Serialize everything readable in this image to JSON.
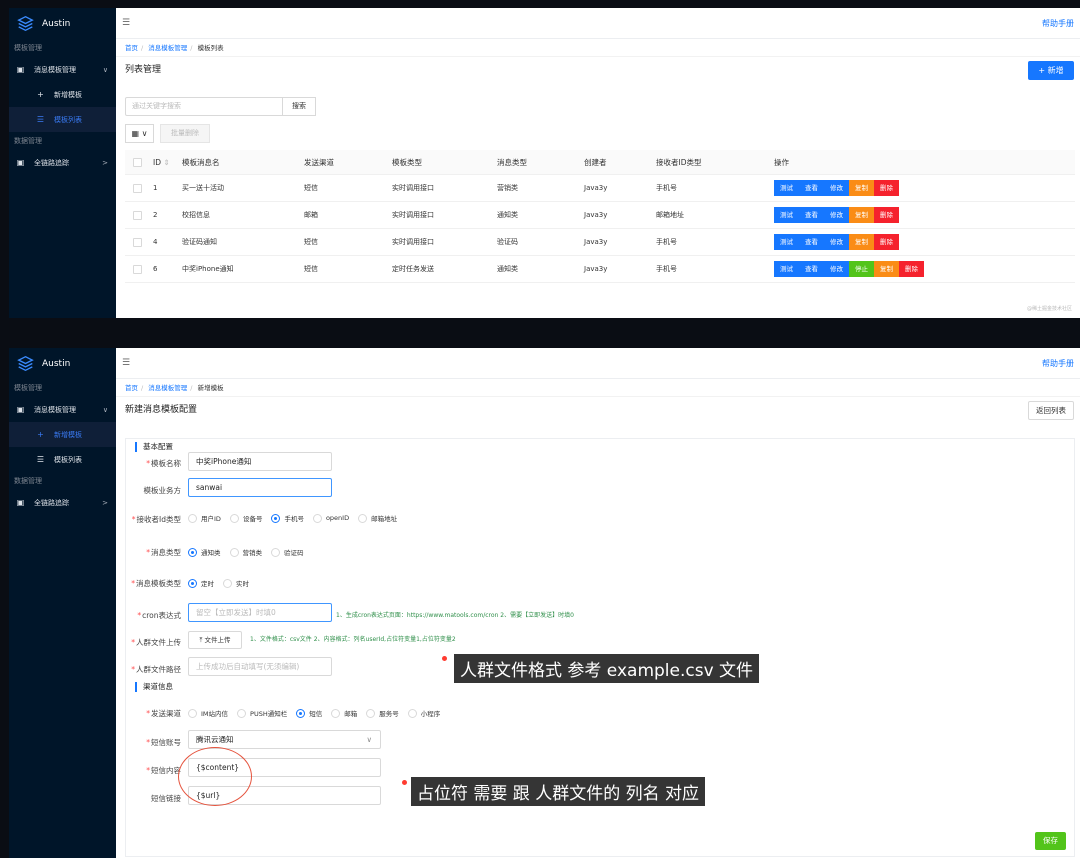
{
  "app": {
    "name": "Austin",
    "help": "帮助手册"
  },
  "sidebar": {
    "section1": "模板管理",
    "group1": "消息模板管理",
    "item_new": "新增模板",
    "item_list": "模板列表",
    "section2": "数据管理",
    "group2": "全链路追踪"
  },
  "list_page": {
    "breadcrumb": [
      "首页",
      "消息模板管理",
      "模板列表"
    ],
    "title": "列表管理",
    "new_button": "新增",
    "search_placeholder": "通过关键字搜索",
    "search_button": "搜索",
    "batch_delete": "批量删除",
    "columns": [
      "ID",
      "模板消息名",
      "发送渠道",
      "模板类型",
      "消息类型",
      "创建者",
      "接收者ID类型",
      "操作"
    ],
    "rows": [
      {
        "id": "1",
        "name": "买一送十活动",
        "channel": "短信",
        "type": "实时调用接口",
        "msg_type": "营销类",
        "creator": "Java3y",
        "receiver": "手机号",
        "ops": [
          "测试",
          "查看",
          "修改",
          "复制",
          "删除"
        ]
      },
      {
        "id": "2",
        "name": "校招信息",
        "channel": "邮箱",
        "type": "实时调用接口",
        "msg_type": "通知类",
        "creator": "Java3y",
        "receiver": "邮箱地址",
        "ops": [
          "测试",
          "查看",
          "修改",
          "复制",
          "删除"
        ]
      },
      {
        "id": "4",
        "name": "验证码通知",
        "channel": "短信",
        "type": "实时调用接口",
        "msg_type": "验证码",
        "creator": "Java3y",
        "receiver": "手机号",
        "ops": [
          "测试",
          "查看",
          "修改",
          "复制",
          "删除"
        ]
      },
      {
        "id": "6",
        "name": "中奖iPhone通知",
        "channel": "短信",
        "type": "定时任务发送",
        "msg_type": "通知类",
        "creator": "Java3y",
        "receiver": "手机号",
        "ops": [
          "测试",
          "查看",
          "修改",
          "停止",
          "复制",
          "删除"
        ]
      }
    ],
    "watermark": "@稀土掘金技术社区"
  },
  "form_page": {
    "breadcrumb": [
      "首页",
      "消息模板管理",
      "新增模板"
    ],
    "title": "新建消息模板配置",
    "back_button": "返回列表",
    "basic_section": "基本配置",
    "labels": {
      "name": "模板名称",
      "owner": "模板业务方",
      "id_type": "接收者Id类型",
      "msg_type": "消息类型",
      "tpl_type": "消息模板类型",
      "cron": "cron表达式",
      "upload": "人群文件上传",
      "path": "人群文件路径",
      "channel": "发送渠道",
      "sms_account": "短信账号",
      "sms_content": "短信内容",
      "sms_link": "短信链接"
    },
    "values": {
      "name": "中奖iPhone通知",
      "owner": "sanwai",
      "cron_placeholder": "留空【立即发送】时填0",
      "path_placeholder": "上传成功后自动填写(无须编辑)",
      "sms_account": "腾讯云通知",
      "sms_content": "{$content}",
      "sms_link": "{$url}"
    },
    "id_type_options": [
      "用户ID",
      "设备号",
      "手机号",
      "openID",
      "邮箱地址"
    ],
    "msg_type_options": [
      "通知类",
      "营销类",
      "验证码"
    ],
    "tpl_type_options": [
      "定时",
      "实时"
    ],
    "channel_options": [
      "IM站内信",
      "PUSH通知栏",
      "短信",
      "邮箱",
      "服务号",
      "小程序"
    ],
    "cron_hint": "1、生成cron表达式页面：https://www.matools.com/cron 2、需要【立即发送】时填0",
    "upload_button": "文件上传",
    "upload_hint": "1、文件格式：csv文件 2、内容格式：列名userId,占位符变量1,占位符变量2",
    "channel_section": "渠道信息",
    "save_button": "保存",
    "note1": "人群文件格式 参考 example.csv 文件",
    "note2": "占位符 需要 跟 人群文件的 列名 对应"
  },
  "colors": {
    "primary": "#1677ff",
    "warning": "#fa8c16",
    "danger": "#f5222d",
    "success": "#52c41a",
    "sider": "#001529"
  }
}
